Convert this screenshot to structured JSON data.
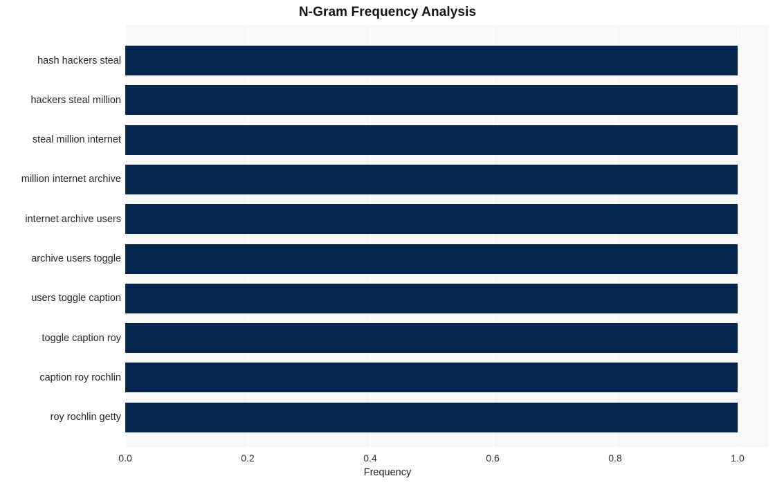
{
  "chart_data": {
    "type": "bar",
    "orientation": "horizontal",
    "title": "N-Gram Frequency Analysis",
    "xlabel": "Frequency",
    "ylabel": "",
    "xlim": [
      0.0,
      1.0
    ],
    "xticks": [
      "0.0",
      "0.2",
      "0.4",
      "0.6",
      "0.8",
      "1.0"
    ],
    "xtick_values": [
      0.0,
      0.2,
      0.4,
      0.6,
      0.8,
      1.0
    ],
    "grid": true,
    "legend": false,
    "categories": [
      "hash hackers steal",
      "hackers steal million",
      "steal million internet",
      "million internet archive",
      "internet archive users",
      "archive users toggle",
      "users toggle caption",
      "toggle caption roy",
      "caption roy rochlin",
      "roy rochlin getty"
    ],
    "values": [
      1.0,
      1.0,
      1.0,
      1.0,
      1.0,
      1.0,
      1.0,
      1.0,
      1.0,
      1.0
    ],
    "bar_color": "#04254d",
    "plot_background": "#f7f7f7",
    "figure_background": "#ffffff",
    "gridline_color": "#ffffff"
  }
}
